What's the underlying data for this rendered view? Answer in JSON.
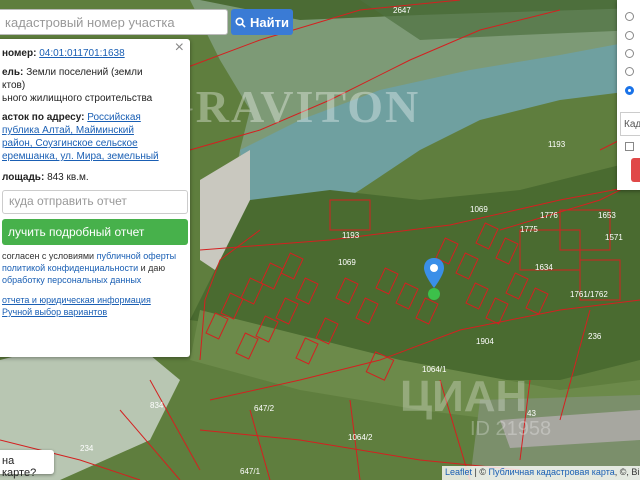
{
  "search": {
    "placeholder": "кадастровый номер участка",
    "button_label": "Найти"
  },
  "panel": {
    "close_label": "×",
    "number_label": "номер:",
    "number_value": "04:01:011701:1638",
    "category_label": "ель:",
    "category_value": "Земли поселений (земли",
    "category_value_2": "ктов)",
    "use_value": "ьного жилищного строительства",
    "address_label": "асток по адресу:",
    "address_line1": "Российская",
    "address_line2": "публика Алтай, Майминский",
    "address_line3": "район, Соузгинское сельское",
    "address_line4": "еремшанка, ул. Мира, земельный",
    "area_label": "лощадь:",
    "area_value": "843 кв.м.",
    "report_placeholder": "куда отправить отчет",
    "report_button": "лучить подробный отчет",
    "fine_print_1": "согласен с условиями",
    "fine_link_1": "публичной оферты",
    "fine_link_2": "политикой конфиденциальности",
    "fine_print_2": "и даю",
    "fine_link_3": "обработку персональных данных",
    "link_report": "отчета и юридическая информация",
    "link_manual": "Ручной выбор вариантов"
  },
  "right_panel": {
    "input_placeholder": "Када"
  },
  "map": {
    "watermark": "GRAVITON",
    "cian": "ЦИАН",
    "cian_id": "ID 21958",
    "labels": [
      "2647",
      "1193",
      "1069",
      "1069",
      "1193",
      "1776",
      "1775",
      "1653",
      "1571",
      "1634",
      "1904",
      "236",
      "1064/1",
      "1064/2",
      "647/2",
      "647/1",
      "834",
      "234",
      "43",
      "1761/1762"
    ]
  },
  "question_label": "на карте?",
  "attribution": {
    "leaflet": "Leaflet",
    "sep": " | © ",
    "pkk": "Публичная кадастровая карта",
    "rest": ", ©, Bing"
  }
}
